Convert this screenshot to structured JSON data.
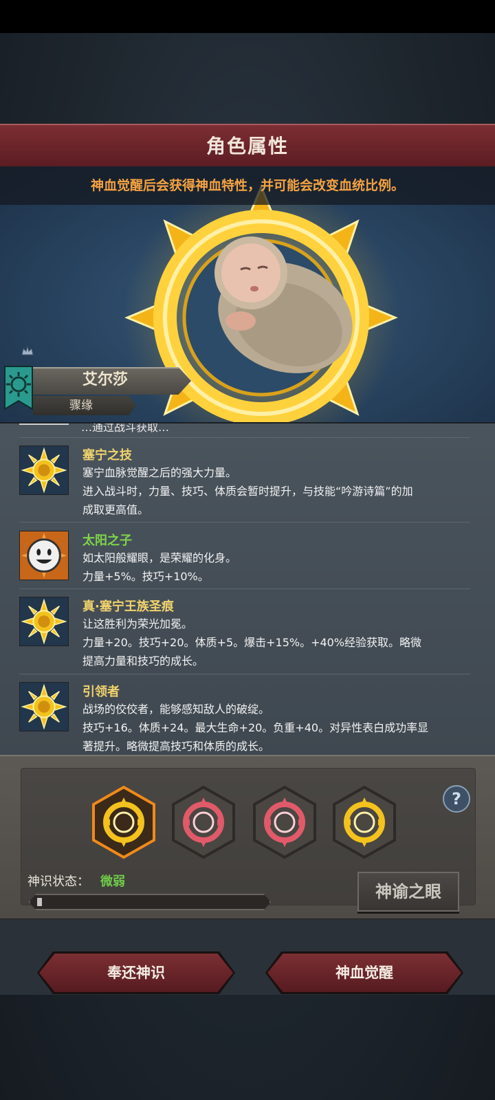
{
  "header": {
    "title": "角色属性"
  },
  "portrait": {
    "hint": "神血觉醒后会获得神血特性，并可能会改变血统比例。"
  },
  "character": {
    "name": "艾尔莎",
    "relation": "骤缘"
  },
  "traits": {
    "clipped_text": "…通过战斗获取…",
    "items": [
      {
        "name": "塞宁之技",
        "name_color": "#f1d36c",
        "icon": "sun-emblem-icon",
        "lines": [
          "塞宁血脉觉醒之后的强大力量。",
          "进入战斗时，力量、技巧、体质会暂时提升，与技能“吟游诗篇”的加",
          "成取更高值。"
        ]
      },
      {
        "name": "太阳之子",
        "name_color": "#7ed54a",
        "icon": "smiley-sun-icon",
        "lines": [
          "如太阳般耀眼，是荣耀的化身。",
          "力量+5%。技巧+10%。"
        ]
      },
      {
        "name": "真·塞宁王族圣痕",
        "name_color": "#f1d36c",
        "icon": "sun-emblem-icon",
        "lines": [
          "让这胜利为荣光加冕。",
          "力量+20。技巧+20。体质+5。爆击+15%。+40%经验获取。略微",
          "提高力量和技巧的成长。"
        ]
      },
      {
        "name": "引领者",
        "name_color": "#f1d36c",
        "icon": "sun-emblem-icon",
        "lines": [
          "战场的佼佼者，能够感知敌人的破绽。",
          "技巧+16。体质+24。最大生命+20。负重+40。对异性表白成功率显",
          "著提升。略微提高技巧和体质的成长。"
        ]
      }
    ]
  },
  "oracle": {
    "slots": [
      {
        "type": "gold",
        "selected": true
      },
      {
        "type": "red",
        "selected": false
      },
      {
        "type": "red",
        "selected": false
      },
      {
        "type": "gold",
        "selected": false
      }
    ],
    "help_label": "?",
    "state_label": "神识状态：",
    "state_value": "微弱",
    "progress": 0.02,
    "eye_button": "神谕之眼"
  },
  "actions": {
    "return": "奉还神识",
    "awaken": "神血觉醒"
  }
}
